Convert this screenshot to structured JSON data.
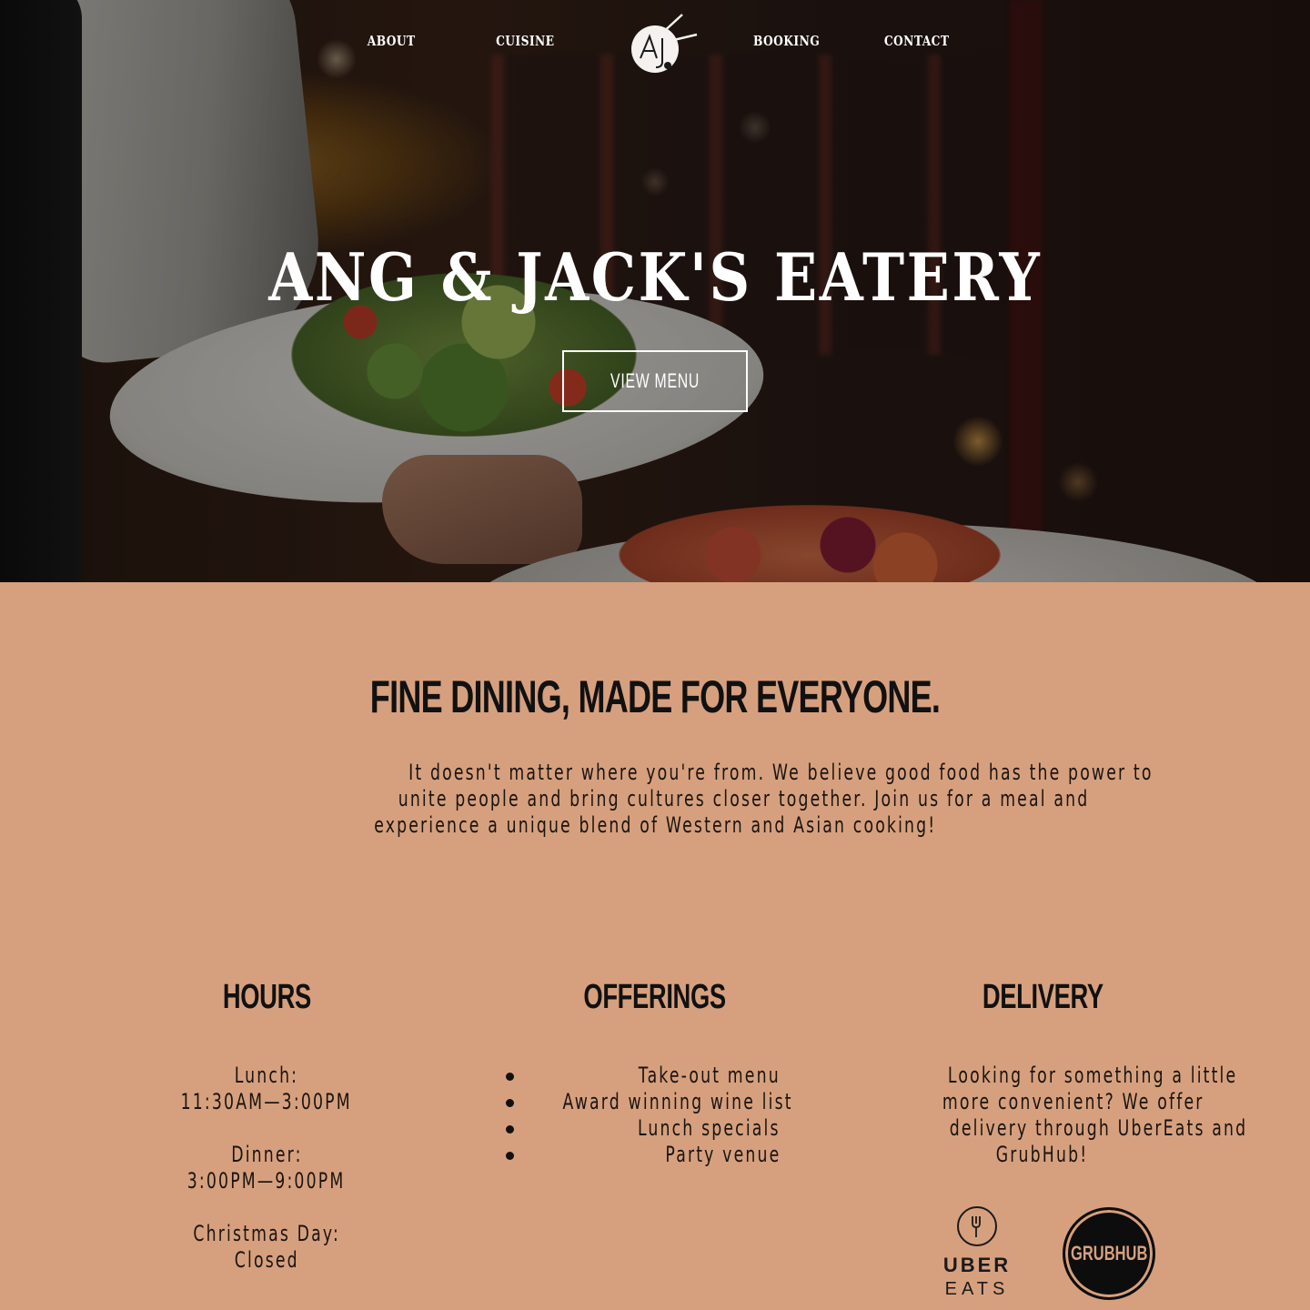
{
  "nav": {
    "about": "ABOUT",
    "cuisine": "CUISINE",
    "booking": "BOOKING",
    "contact": "CONTACT",
    "logo_icon": "aj-monogram-logo"
  },
  "hero": {
    "title": "ANG & JACK'S EATERY",
    "button": "VIEW MENU"
  },
  "intro": {
    "heading": "FINE DINING, MADE FOR EVERYONE.",
    "line1": "It doesn't matter where you're from. We believe good food has the power to",
    "line2": "unite people and bring cultures closer together. Join us for a meal and",
    "line3": "experience a unique blend of Western and Asian cooking!"
  },
  "hours": {
    "heading": "HOURS",
    "lunch_label": "Lunch:",
    "lunch_time": "11:30AM—3:00PM",
    "dinner_label": "Dinner:",
    "dinner_time": "3:00PM—9:00PM",
    "xmas_label": "Christmas Day:",
    "xmas_value": "Closed"
  },
  "offerings": {
    "heading": "OFFERINGS",
    "items": [
      "Take-out menu",
      "Award winning wine list",
      "Lunch specials",
      "Party venue"
    ]
  },
  "delivery": {
    "heading": "DELIVERY",
    "line1": "Looking for something a little",
    "line2": "more convenient? We offer",
    "line3": "delivery through UberEats and",
    "line4": "GrubHub!",
    "uber_word1": "UBER",
    "uber_word2": "EATS",
    "grubhub_label": "GRUBHUB"
  },
  "colors": {
    "section_bg": "#d6a07e",
    "text_dark": "#111111",
    "hero_text": "#ffffff"
  }
}
